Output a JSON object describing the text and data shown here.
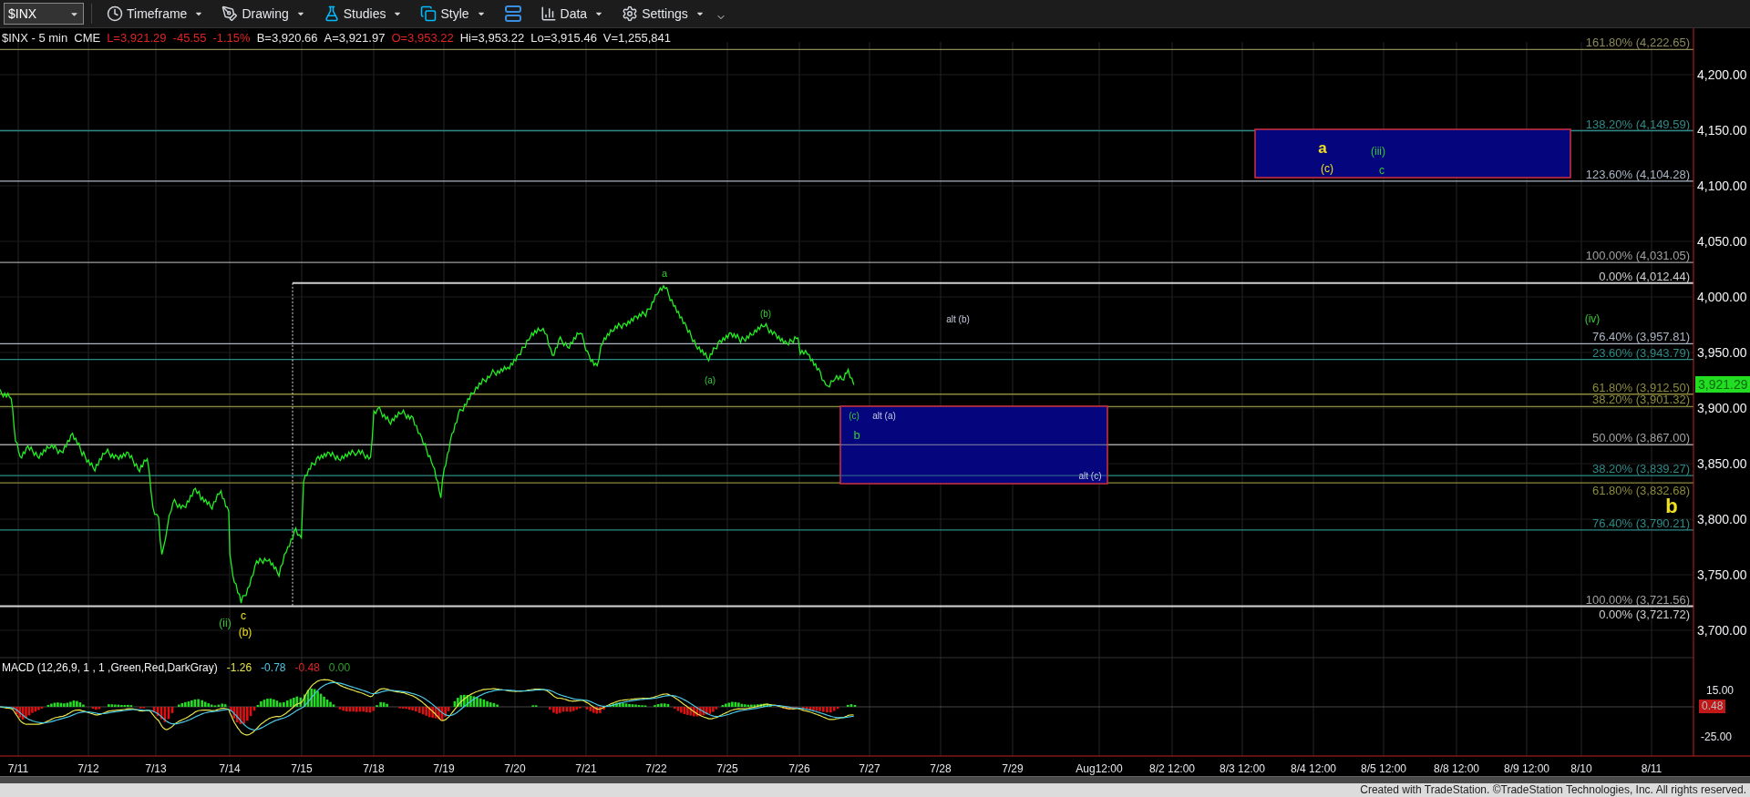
{
  "toolbar": {
    "symbol_field": {
      "value": "$INX"
    },
    "buttons": [
      {
        "kind": "clock",
        "label": "Timeframe"
      },
      {
        "kind": "pen",
        "label": "Drawing"
      },
      {
        "kind": "flask",
        "label": "Studies"
      },
      {
        "kind": "copy",
        "label": "Style"
      },
      {
        "kind": "layout"
      },
      {
        "kind": "chart",
        "label": "Data"
      },
      {
        "kind": "gear",
        "label": "Settings"
      }
    ]
  },
  "info_line": [
    {
      "text": "$INX - 5 min",
      "down": false
    },
    {
      "text": "CME",
      "down": false
    },
    {
      "text": "L=3,921.29",
      "down": true
    },
    {
      "text": "-45.55",
      "down": true
    },
    {
      "text": "-1.15%",
      "down": true
    },
    {
      "text": "B=3,920.66",
      "down": false
    },
    {
      "text": "A=3,921.97",
      "down": false
    },
    {
      "text": "O=3,953.22",
      "down": true
    },
    {
      "text": "Hi=3,953.22",
      "down": false
    },
    {
      "text": "Lo=3,915.46",
      "down": false
    },
    {
      "text": "V=1,255,841",
      "down": false
    }
  ],
  "chart": {
    "price_axis": {
      "ticks": [
        "4,200.00",
        "4,150.00",
        "4,100.00",
        "4,050.00",
        "4,000.00",
        "3,950.00",
        "3,900.00",
        "3,850.00",
        "3,800.00",
        "3,750.00",
        "3,700.00"
      ],
      "last_price": "3,921.29"
    },
    "fib_levels": [
      {
        "label": "161.80% (4,222.65)",
        "color": "#8c8a5c"
      },
      {
        "label": "138.20% (4,149.59)",
        "color": "#2e8a86"
      },
      {
        "label": "123.60% (4,104.28)",
        "color": "#aab4c4"
      },
      {
        "label": "100.00% (4,031.05)",
        "color": "#a0a0a0"
      },
      {
        "label": "0.00% (4,012.44)",
        "color": "#cfcfcf"
      },
      {
        "label": "76.40% (3,957.81)",
        "color": "#aab4c4"
      },
      {
        "label": "23.60% (3,943.79)",
        "color": "#2e8a86"
      },
      {
        "label": "61.80% (3,912.50)",
        "color": "#8c8a3c"
      },
      {
        "label": "38.20% (3,901.32)",
        "color": "#8c8a3c"
      },
      {
        "label": "50.00% (3,867.00)",
        "color": "#a0a0a0"
      },
      {
        "label": "38.20% (3,839.27)",
        "color": "#2e8a86"
      },
      {
        "label": "61.80% (3,832.68)",
        "color": "#8c8a3c"
      },
      {
        "label": "76.40% (3,790.21)",
        "color": "#2e8a86"
      },
      {
        "label": "100.00% (3,721.56)",
        "color": "#a0a0a0"
      },
      {
        "label": "0.00% (3,721.72)",
        "color": "#cfcfcf"
      }
    ],
    "annotations": [
      {
        "text": "a",
        "kind": "minor"
      },
      {
        "text": "(b)",
        "kind": "minor"
      },
      {
        "text": "(a)",
        "kind": "minor"
      },
      {
        "text": "alt (b)",
        "kind": "alt"
      },
      {
        "text": "(iv)",
        "kind": "minor"
      },
      {
        "text": "(c)",
        "kind": "minor"
      },
      {
        "text": "alt (a)",
        "kind": "alt"
      },
      {
        "text": "b",
        "kind": "minor"
      },
      {
        "text": "alt (c)",
        "kind": "alt"
      },
      {
        "text": "a",
        "kind": "major"
      },
      {
        "text": "(iii)",
        "kind": "minor"
      },
      {
        "text": "(c)",
        "kind": "major"
      },
      {
        "text": "c",
        "kind": "minor"
      },
      {
        "text": "b",
        "kind": "major"
      },
      {
        "text": "(ii)",
        "kind": "minor"
      },
      {
        "text": "c",
        "kind": "major"
      },
      {
        "text": "(b)",
        "kind": "major"
      }
    ],
    "date_axis": [
      "7/11",
      "7/12",
      "7/13",
      "7/14",
      "7/15",
      "7/18",
      "7/19",
      "7/20",
      "7/21",
      "7/22",
      "7/25",
      "7/26",
      "7/27",
      "7/28",
      "7/29",
      "Aug12:00",
      "8/2 12:00",
      "8/3 12:00",
      "8/4 12:00",
      "8/5 12:00",
      "8/8 12:00",
      "8/9 12:00",
      "8/10",
      "8/11"
    ]
  },
  "macd": {
    "title": "MACD (12,26,9, 1 , 1 ,Green,Red,DarkGray)",
    "values": [
      {
        "text": "-1.26",
        "color": "#e6e64a"
      },
      {
        "text": "-0.78",
        "color": "#4ac8e6"
      },
      {
        "text": "-0.48",
        "color": "#e02424"
      },
      {
        "text": "0.00",
        "color": "#2ea02e"
      }
    ],
    "ticks": [
      "15.00",
      "-25.00"
    ],
    "last_value": "0.48"
  },
  "footer": "Created with TradeStation. ©TradeStation Technologies, Inc. All rights reserved."
}
